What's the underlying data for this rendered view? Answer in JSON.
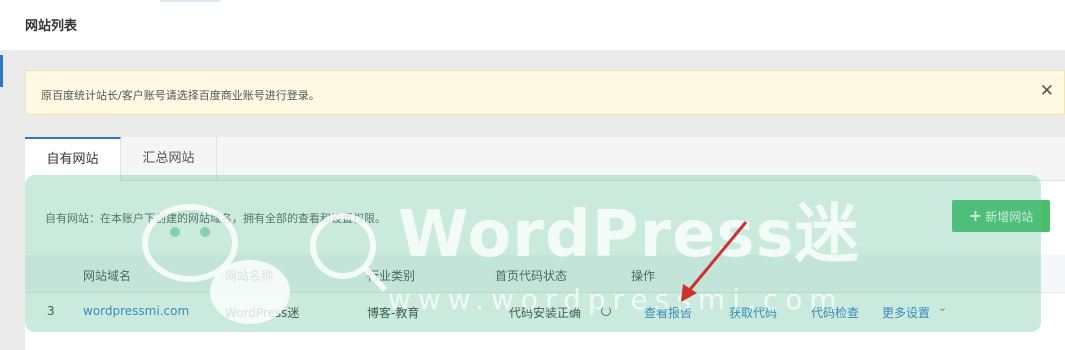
{
  "header": {
    "title": "网站列表"
  },
  "notice": {
    "text": "原百度统计站长/客户账号请选择百度商业账号进行登录。",
    "close_symbol": "✕"
  },
  "tabs": [
    {
      "label": "自有网站",
      "active": true
    },
    {
      "label": "汇总网站",
      "active": false
    }
  ],
  "description": "自有网站：在本账户下创建的网站域名，拥有全部的查看和设置权限。",
  "add_button": {
    "plus": "+",
    "label": "新增网站"
  },
  "table": {
    "headers": [
      "网站域名",
      "网站名称",
      "行业类别",
      "首页代码状态",
      "操作"
    ],
    "rows": [
      {
        "index": "3",
        "domain": "wordpressmi.com",
        "name": "WordPress迷",
        "industry": "博客-教育",
        "code_status": "代码安装正确",
        "actions": [
          "查看报告",
          "获取代码",
          "代码检查",
          "更多设置"
        ]
      }
    ]
  },
  "watermark": {
    "text": "WordPress迷",
    "url": "www.wordpressmi.com"
  },
  "colors": {
    "link": "#2f77c9",
    "add_button": "#4cbf6a",
    "arrow": "#d0302f",
    "notice_bg": "#fdf9e3"
  },
  "icons": [
    "close-icon",
    "plus-icon",
    "refresh-icon",
    "chevron-down-icon",
    "wechat-icon",
    "search-icon"
  ]
}
